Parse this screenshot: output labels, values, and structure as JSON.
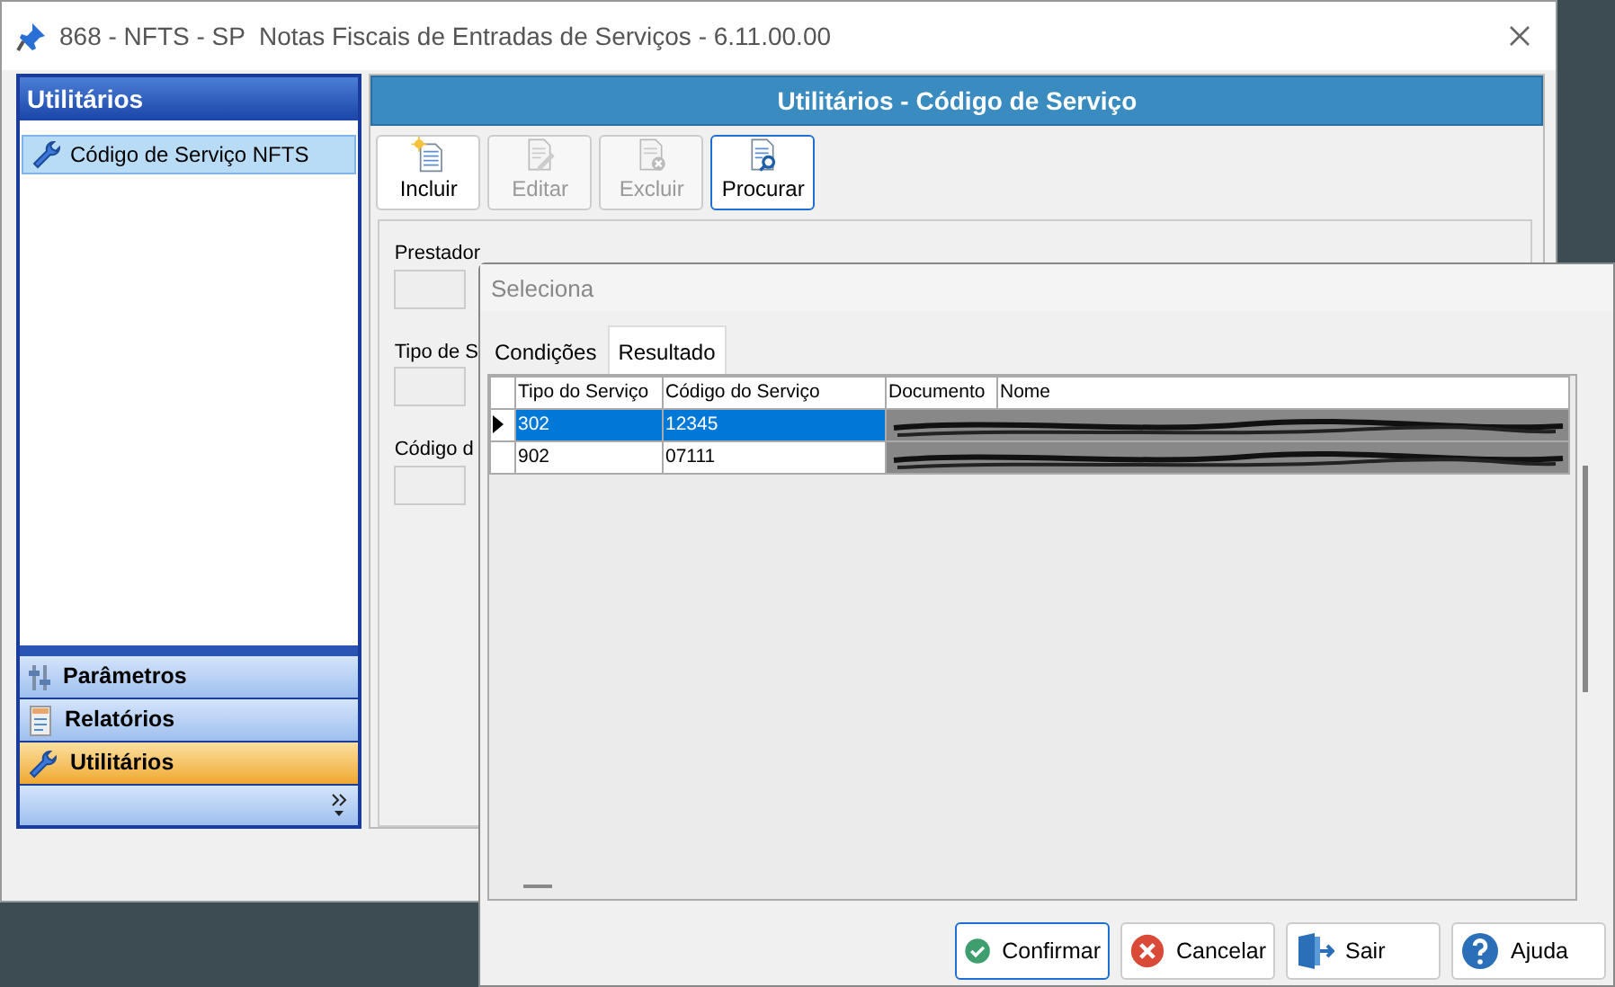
{
  "window": {
    "title": "868 - NFTS - SP  Notas Fiscais de Entradas de Serviços - 6.11.00.00"
  },
  "sidebar": {
    "title": "Utilitários",
    "items": [
      {
        "label": "Código de Serviço NFTS",
        "selected": true
      }
    ],
    "sections": [
      {
        "label": "Parâmetros",
        "selected": false
      },
      {
        "label": "Relatórios",
        "selected": false
      },
      {
        "label": "Utilitários",
        "selected": true
      }
    ]
  },
  "panel": {
    "title": "Utilitários - Código de Serviço",
    "toolbar": [
      {
        "label": "Incluir",
        "disabled": false,
        "focused": false
      },
      {
        "label": "Editar",
        "disabled": true,
        "focused": false
      },
      {
        "label": "Excluir",
        "disabled": true,
        "focused": false
      },
      {
        "label": "Procurar",
        "disabled": false,
        "focused": true
      }
    ],
    "fields": [
      {
        "label": "Prestador"
      },
      {
        "label": "Tipo de S"
      },
      {
        "label": "Código d"
      }
    ]
  },
  "dialog": {
    "title": "Seleciona",
    "tabs": [
      {
        "label": "Condições",
        "selected": false
      },
      {
        "label": "Resultado",
        "selected": true
      }
    ],
    "table": {
      "columns": [
        "Tipo do Serviço",
        "Código do Serviço",
        "Documento",
        "Nome"
      ],
      "rows": [
        {
          "cells": [
            "302",
            "12345"
          ],
          "selected": true
        },
        {
          "cells": [
            "902",
            "07111"
          ],
          "selected": false
        }
      ]
    },
    "buttons": [
      {
        "label": "Confirmar",
        "focused": true
      },
      {
        "label": "Cancelar",
        "focused": false
      },
      {
        "label": "Sair",
        "focused": false
      },
      {
        "label": "Ajuda",
        "focused": false
      }
    ]
  }
}
